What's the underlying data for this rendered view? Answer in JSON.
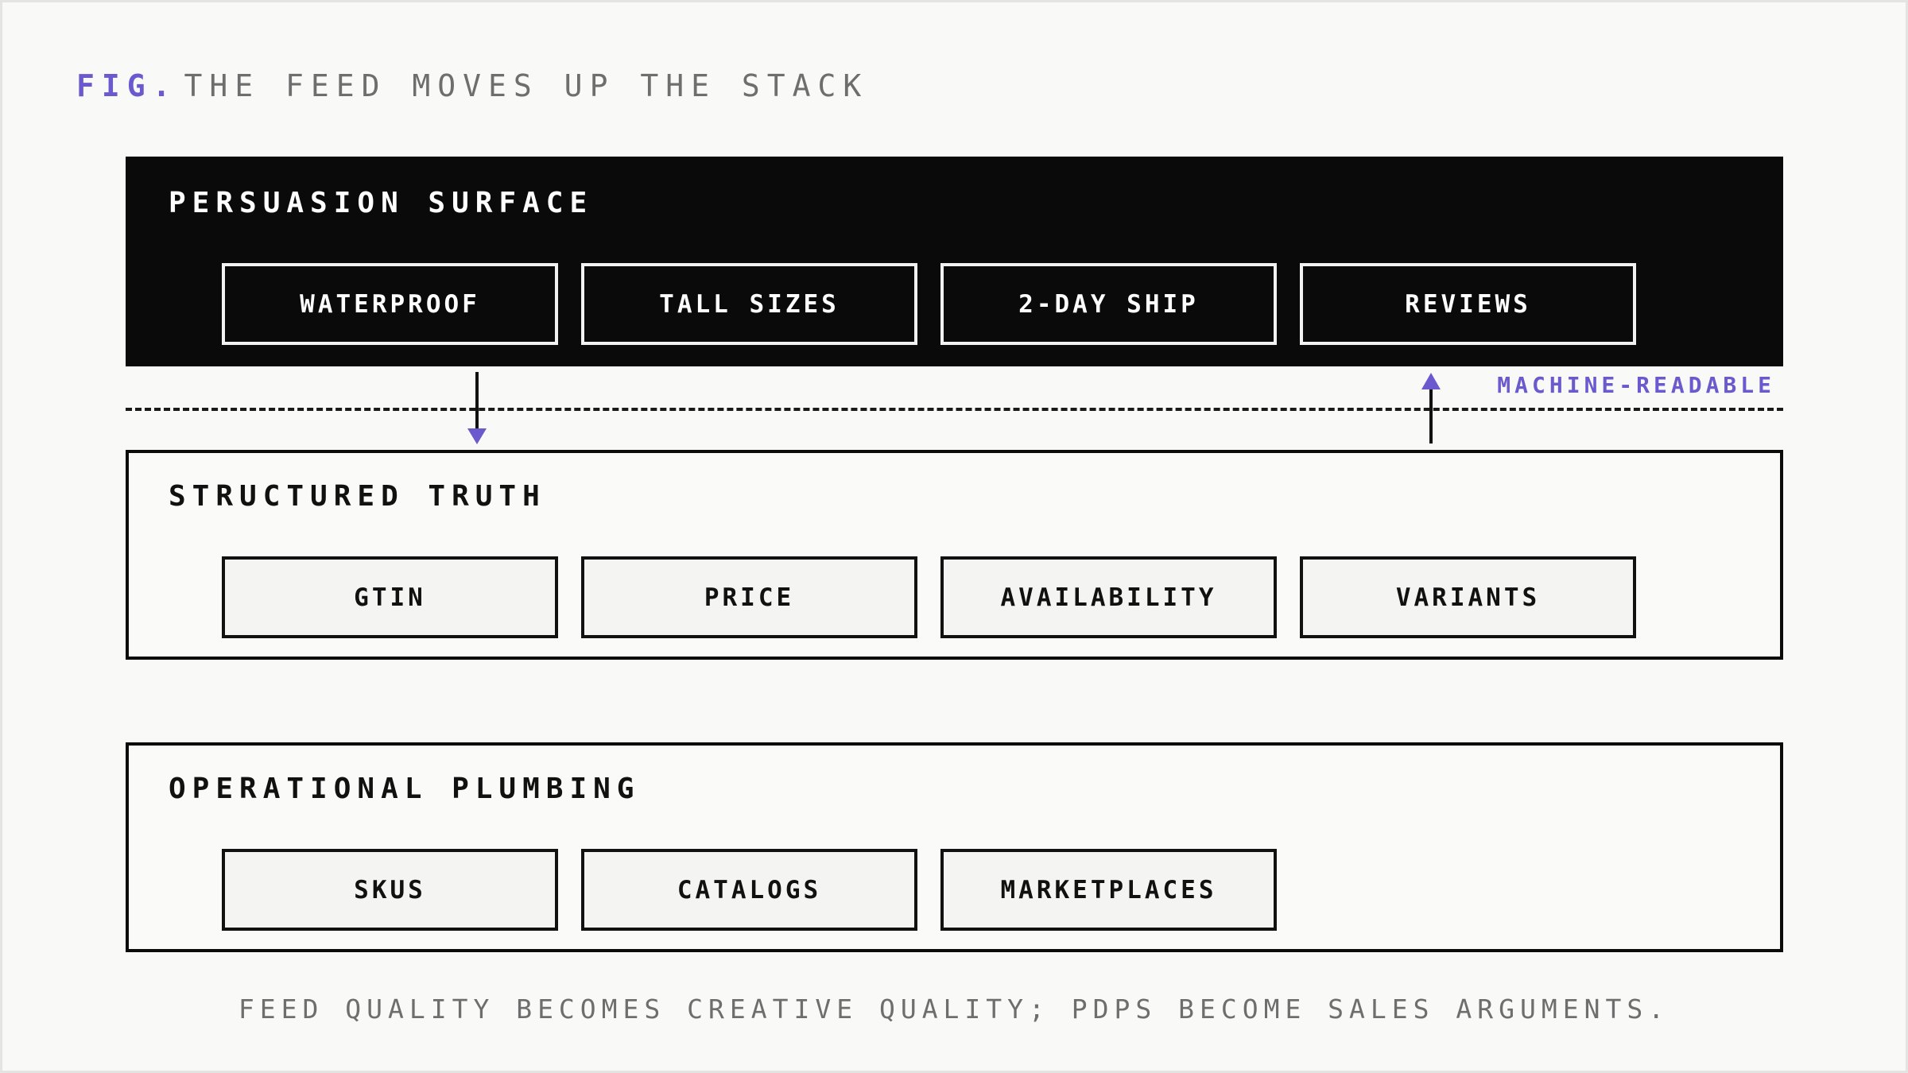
{
  "figure": {
    "prefix": "FIG.",
    "title": "THE FEED MOVES UP THE STACK"
  },
  "layers": [
    {
      "label": "PERSUASION SURFACE",
      "items": [
        "WATERPROOF",
        "TALL SIZES",
        "2-DAY SHIP",
        "REVIEWS"
      ]
    },
    {
      "label": "STRUCTURED TRUTH",
      "items": [
        "GTIN",
        "PRICE",
        "AVAILABILITY",
        "VARIANTS"
      ]
    },
    {
      "label": "OPERATIONAL PLUMBING",
      "items": [
        "SKUS",
        "CATALOGS",
        "MARKETPLACES"
      ]
    }
  ],
  "divider_label": "MACHINE-READABLE",
  "caption": "FEED QUALITY BECOMES CREATIVE QUALITY; PDPS BECOME SALES ARGUMENTS.",
  "colors": {
    "accent": "#6a5acd",
    "ink": "#0a0a0a",
    "background": "#f9f9f7",
    "muted": "#6e6e6e"
  }
}
